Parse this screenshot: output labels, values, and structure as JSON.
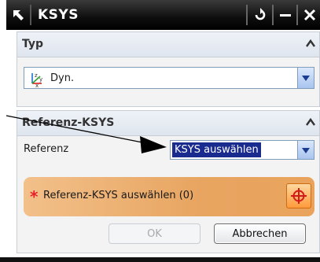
{
  "window": {
    "title": "KSYS"
  },
  "typ_group": {
    "header": "Typ",
    "selected_type": "Dyn.",
    "selected_type_icon": "csys-axes-icon"
  },
  "reference_group": {
    "header": "Referenz-KSYS",
    "reference_label": "Referenz",
    "reference_value": "KSYS auswählen",
    "select_prompt_marker": "*",
    "select_prompt": "Referenz-KSYS auswählen (0)",
    "select_icon": "crosshair-icon"
  },
  "footer": {
    "ok_label": "OK",
    "cancel_label": "Abbrechen"
  },
  "colors": {
    "title_bar": "#000000",
    "selection_row": "#e9a35c",
    "required_star": "#e8202a",
    "highlight_selection": "#1a2b8f"
  }
}
